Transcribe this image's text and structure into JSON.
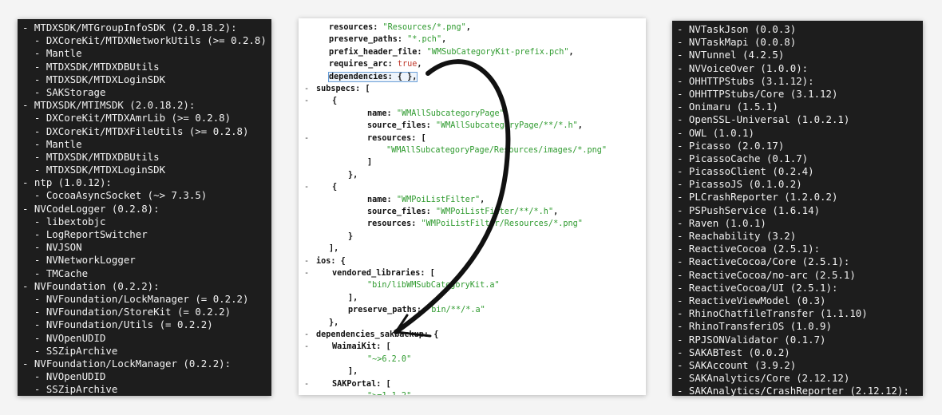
{
  "left_terminal": {
    "lines": [
      "- MTDXSDK/MTGroupInfoSDK (2.0.18.2):",
      "  - DXCoreKit/MTDXNetworkUtils (>= 0.2.8)",
      "  - Mantle",
      "  - MTDXSDK/MTDXDBUtils",
      "  - MTDXSDK/MTDXLoginSDK",
      "  - SAKStorage",
      "- MTDXSDK/MTIMSDK (2.0.18.2):",
      "  - DXCoreKit/MTDXAmrLib (>= 0.2.8)",
      "  - DXCoreKit/MTDXFileUtils (>= 0.2.8)",
      "  - Mantle",
      "  - MTDXSDK/MTDXDBUtils",
      "  - MTDXSDK/MTDXLoginSDK",
      "- ntp (1.0.12):",
      "  - CocoaAsyncSocket (~> 7.3.5)",
      "- NVCodeLogger (0.2.8):",
      "  - libextobjc",
      "  - LogReportSwitcher",
      "  - NVJSON",
      "  - NVNetworkLogger",
      "  - TMCache",
      "- NVFoundation (0.2.2):",
      "  - NVFoundation/LockManager (= 0.2.2)",
      "  - NVFoundation/StoreKit (= 0.2.2)",
      "  - NVFoundation/Utils (= 0.2.2)",
      "  - NVOpenUDID",
      "  - SSZipArchive",
      "- NVFoundation/LockManager (0.2.2):",
      "  - NVOpenUDID",
      "  - SSZipArchive"
    ]
  },
  "right_terminal": {
    "lines": [
      "- NVTaskJson (0.0.3)",
      "- NVTaskMapi (0.0.8)",
      "- NVTunnel (4.2.5)",
      "- NVVoiceOver (1.0.0):",
      "- OHHTTPStubs (3.1.12):",
      "- OHHTTPStubs/Core (3.1.12)",
      "- Onimaru (1.5.1)",
      "- OpenSSL-Universal (1.0.2.1)",
      "- OWL (1.0.1)",
      "- Picasso (2.0.17)",
      "- PicassoCache (0.1.7)",
      "- PicassoClient (0.2.4)",
      "- PicassoJS (0.1.0.2)",
      "- PLCrashReporter (1.2.0.2)",
      "- PSPushService (1.6.14)",
      "- Raven (1.0.1)",
      "- Reachability (3.2)",
      "- ReactiveCocoa (2.5.1):",
      "- ReactiveCocoa/Core (2.5.1):",
      "- ReactiveCocoa/no-arc (2.5.1)",
      "- ReactiveCocoa/UI (2.5.1):",
      "- ReactiveViewModel (0.3)",
      "- RhinoChatfileTransfer (1.1.10)",
      "- RhinoTransferiOS (1.0.9)",
      "- RPJSONValidator (0.1.7)",
      "- SAKABTest (0.0.2)",
      "- SAKAccount (3.9.2)",
      "- SAKAnalytics/Core (2.12.12)",
      "- SAKAnalytics/CrashReporter (2.12.12):"
    ]
  },
  "code_editor": {
    "lines": [
      {
        "l": "",
        "p": [
          {
            "t": "resources: ",
            "c": ""
          },
          {
            "t": "\"Resources/*.png\"",
            "c": "str"
          },
          {
            "t": ",",
            "c": ""
          }
        ]
      },
      {
        "l": "",
        "p": [
          {
            "t": "preserve_paths: ",
            "c": ""
          },
          {
            "t": "\"*.pch\"",
            "c": "str"
          },
          {
            "t": ",",
            "c": ""
          }
        ]
      },
      {
        "l": "",
        "p": [
          {
            "t": "prefix_header_file: ",
            "c": ""
          },
          {
            "t": "\"WMSubCategoryKit-prefix.pch\"",
            "c": "str"
          },
          {
            "t": ",",
            "c": ""
          }
        ]
      },
      {
        "l": "",
        "p": [
          {
            "t": "requires_arc: ",
            "c": ""
          },
          {
            "t": "true",
            "c": "kw"
          },
          {
            "t": ",",
            "c": ""
          }
        ]
      },
      {
        "l": "",
        "p": [
          {
            "t": "dependencies: { },",
            "c": "hl"
          }
        ]
      },
      {
        "l": "-",
        "p": [
          {
            "t": "subspecs: [",
            "c": ""
          }
        ]
      },
      {
        "l": "-",
        "p": [
          {
            "t": "{",
            "c": ""
          }
        ]
      },
      {
        "l": "",
        "p": [
          {
            "t": "name: ",
            "c": ""
          },
          {
            "t": "\"WMAllSubcategoryPage\"",
            "c": "str"
          },
          {
            "t": ",",
            "c": ""
          }
        ]
      },
      {
        "l": "",
        "p": [
          {
            "t": "source_files: ",
            "c": ""
          },
          {
            "t": "\"WMAllSubcategoryPage/**/*.h\"",
            "c": "str"
          },
          {
            "t": ",",
            "c": ""
          }
        ]
      },
      {
        "l": "-",
        "p": [
          {
            "t": "resources: [",
            "c": ""
          }
        ]
      },
      {
        "l": "",
        "p": [
          {
            "t": "\"WMAllSubcategoryPage/Resources/images/*.png\"",
            "c": "str"
          }
        ]
      },
      {
        "l": "",
        "p": [
          {
            "t": "]",
            "c": ""
          }
        ]
      },
      {
        "l": "",
        "p": [
          {
            "t": "},",
            "c": ""
          }
        ]
      },
      {
        "l": "-",
        "p": [
          {
            "t": "{",
            "c": ""
          }
        ]
      },
      {
        "l": "",
        "p": [
          {
            "t": "name: ",
            "c": ""
          },
          {
            "t": "\"WMPoiListFilter\"",
            "c": "str"
          },
          {
            "t": ",",
            "c": ""
          }
        ]
      },
      {
        "l": "",
        "p": [
          {
            "t": "source_files: ",
            "c": ""
          },
          {
            "t": "\"WMPoiListFilter/**/*.h\"",
            "c": "str"
          },
          {
            "t": ",",
            "c": ""
          }
        ]
      },
      {
        "l": "",
        "p": [
          {
            "t": "resources: ",
            "c": ""
          },
          {
            "t": "\"WMPoiListFilter/Resources/*.png\"",
            "c": "str"
          }
        ]
      },
      {
        "l": "",
        "p": [
          {
            "t": "}",
            "c": ""
          }
        ]
      },
      {
        "l": "",
        "p": [
          {
            "t": "],",
            "c": ""
          }
        ]
      },
      {
        "l": "-",
        "p": [
          {
            "t": "ios: {",
            "c": ""
          }
        ]
      },
      {
        "l": "-",
        "p": [
          {
            "t": "vendored_libraries: [",
            "c": ""
          }
        ]
      },
      {
        "l": "",
        "p": [
          {
            "t": "\"bin/libWMSubCategoryKit.a\"",
            "c": "str"
          }
        ]
      },
      {
        "l": "",
        "p": [
          {
            "t": "],",
            "c": ""
          }
        ]
      },
      {
        "l": "",
        "p": [
          {
            "t": "preserve_paths: ",
            "c": ""
          },
          {
            "t": "\"bin/**/*.a\"",
            "c": "str"
          }
        ]
      },
      {
        "l": "",
        "p": [
          {
            "t": "},",
            "c": ""
          }
        ]
      },
      {
        "l": "-",
        "p": [
          {
            "t": "dependencies_sakbackup: {",
            "c": ""
          }
        ]
      },
      {
        "l": "-",
        "p": [
          {
            "t": "WaimaiKit: [",
            "c": ""
          }
        ]
      },
      {
        "l": "",
        "p": [
          {
            "t": "\"~>6.2.0\"",
            "c": "str"
          }
        ]
      },
      {
        "l": "",
        "p": [
          {
            "t": "],",
            "c": ""
          }
        ]
      },
      {
        "l": "-",
        "p": [
          {
            "t": "SAKPortal: [",
            "c": ""
          }
        ]
      },
      {
        "l": "",
        "p": [
          {
            "t": "\">=1.1.2\"",
            "c": "str"
          }
        ]
      },
      {
        "l": "",
        "p": [
          {
            "t": "]",
            "c": ""
          }
        ]
      },
      {
        "l": "",
        "p": [
          {
            "t": "}",
            "c": ""
          }
        ]
      }
    ]
  },
  "colors": {
    "terminal_bg": "#1d1d1d",
    "terminal_fg": "#f2f2f2",
    "string_green": "#2e9a2e",
    "keyword_red": "#c0392b",
    "arrow": "#111111"
  }
}
